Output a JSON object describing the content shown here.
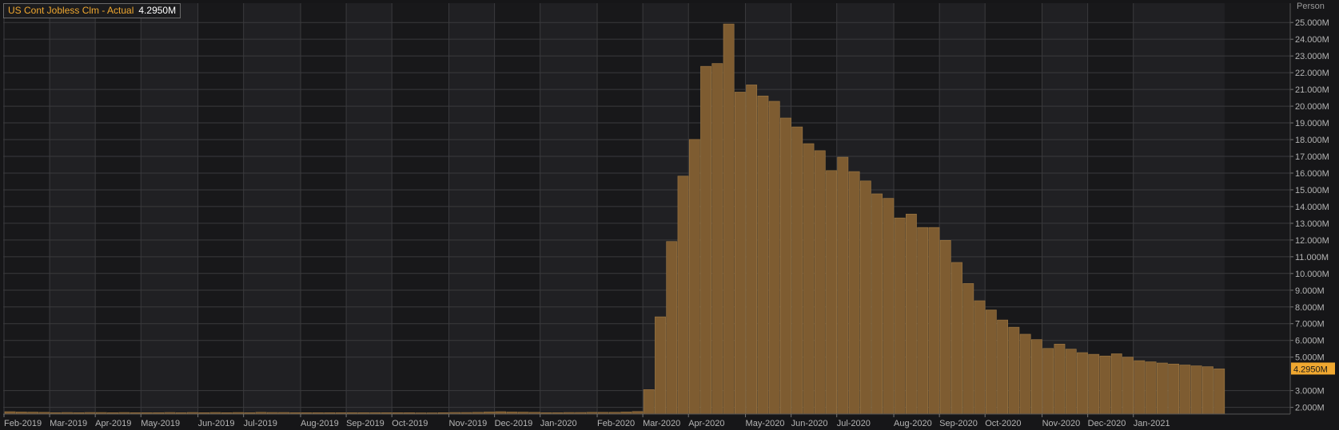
{
  "legend": {
    "name": "US Cont Jobless Clm - Actual",
    "value": "4.2950M"
  },
  "colors": {
    "background": "#161618",
    "plot_dark": "#18181a",
    "plot_light": "#202023",
    "grid": "#3a3a3d",
    "bar": "#7e5c31",
    "bar_edge": "#a07a45",
    "axis_text": "#b5b5b5",
    "accent": "#f0a830",
    "last_value_bg": "#f0a830"
  },
  "chart_data": {
    "type": "bar",
    "yunit": "Person",
    "ylim": [
      1.5,
      25.5
    ],
    "yticks": [
      {
        "value": 2,
        "label": "2.000M"
      },
      {
        "value": 3,
        "label": "3.000M"
      },
      {
        "value": 5,
        "label": "5.000M"
      },
      {
        "value": 6,
        "label": "6.000M"
      },
      {
        "value": 7,
        "label": "7.000M"
      },
      {
        "value": 8,
        "label": "8.000M"
      },
      {
        "value": 9,
        "label": "9.000M"
      },
      {
        "value": 10,
        "label": "10.000M"
      },
      {
        "value": 11,
        "label": "11.000M"
      },
      {
        "value": 12,
        "label": "12.000M"
      },
      {
        "value": 13,
        "label": "13.000M"
      },
      {
        "value": 14,
        "label": "14.000M"
      },
      {
        "value": 15,
        "label": "15.000M"
      },
      {
        "value": 16,
        "label": "16.000M"
      },
      {
        "value": 17,
        "label": "17.000M"
      },
      {
        "value": 18,
        "label": "18.000M"
      },
      {
        "value": 19,
        "label": "19.000M"
      },
      {
        "value": 20,
        "label": "20.000M"
      },
      {
        "value": 21,
        "label": "21.000M"
      },
      {
        "value": 22,
        "label": "22.000M"
      },
      {
        "value": 23,
        "label": "23.000M"
      },
      {
        "value": 24,
        "label": "24.000M"
      },
      {
        "value": 25,
        "label": "25.000M"
      }
    ],
    "last_value": {
      "value": 4.295,
      "label": "4.2950M"
    },
    "month_labels": [
      {
        "label": "Feb-2019",
        "bar": 0
      },
      {
        "label": "Mar-2019",
        "bar": 4
      },
      {
        "label": "Apr-2019",
        "bar": 8
      },
      {
        "label": "May-2019",
        "bar": 12
      },
      {
        "label": "Jun-2019",
        "bar": 17
      },
      {
        "label": "Jul-2019",
        "bar": 21
      },
      {
        "label": "Aug-2019",
        "bar": 26
      },
      {
        "label": "Sep-2019",
        "bar": 30
      },
      {
        "label": "Oct-2019",
        "bar": 34
      },
      {
        "label": "Nov-2019",
        "bar": 39
      },
      {
        "label": "Dec-2019",
        "bar": 43
      },
      {
        "label": "Jan-2020",
        "bar": 47
      },
      {
        "label": "Feb-2020",
        "bar": 52
      },
      {
        "label": "Mar-2020",
        "bar": 56
      },
      {
        "label": "Apr-2020",
        "bar": 60
      },
      {
        "label": "May-2020",
        "bar": 65
      },
      {
        "label": "Jun-2020",
        "bar": 69
      },
      {
        "label": "Jul-2020",
        "bar": 73
      },
      {
        "label": "Aug-2020",
        "bar": 78
      },
      {
        "label": "Sep-2020",
        "bar": 82
      },
      {
        "label": "Oct-2020",
        "bar": 86
      },
      {
        "label": "Nov-2020",
        "bar": 91
      },
      {
        "label": "Dec-2020",
        "bar": 95
      },
      {
        "label": "Jan-2021",
        "bar": 99
      }
    ],
    "values": [
      1.74,
      1.72,
      1.71,
      1.7,
      1.68,
      1.69,
      1.68,
      1.69,
      1.69,
      1.68,
      1.69,
      1.68,
      1.68,
      1.68,
      1.69,
      1.68,
      1.69,
      1.68,
      1.69,
      1.68,
      1.69,
      1.68,
      1.7,
      1.69,
      1.69,
      1.68,
      1.68,
      1.68,
      1.68,
      1.68,
      1.68,
      1.68,
      1.68,
      1.68,
      1.68,
      1.68,
      1.67,
      1.67,
      1.68,
      1.69,
      1.69,
      1.7,
      1.72,
      1.74,
      1.72,
      1.71,
      1.7,
      1.68,
      1.68,
      1.69,
      1.69,
      1.7,
      1.7,
      1.7,
      1.72,
      1.75,
      3.06,
      7.41,
      11.91,
      15.82,
      18.01,
      22.38,
      22.55,
      24.91,
      20.84,
      21.27,
      20.61,
      20.29,
      19.29,
      18.76,
      17.76,
      17.34,
      16.15,
      16.95,
      16.09,
      15.53,
      14.76,
      14.49,
      13.32,
      13.55,
      12.75,
      12.75,
      11.98,
      10.66,
      9.4,
      8.37,
      7.82,
      7.22,
      6.79,
      6.37,
      6.05,
      5.52,
      5.78,
      5.48,
      5.27,
      5.17,
      5.07,
      5.2,
      5.0,
      4.79,
      4.72,
      4.65,
      4.59,
      4.53,
      4.48,
      4.43,
      4.3
    ]
  }
}
